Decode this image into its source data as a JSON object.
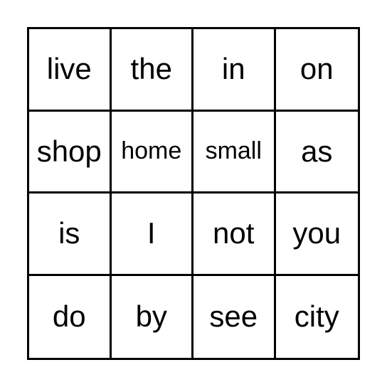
{
  "board": {
    "rows": [
      [
        "live",
        "the",
        "in",
        "on"
      ],
      [
        "shop",
        "home",
        "small",
        "as"
      ],
      [
        "is",
        "I",
        "not",
        "you"
      ],
      [
        "do",
        "by",
        "see",
        "city"
      ]
    ]
  },
  "colors": {
    "border": "#000000",
    "background": "#ffffff",
    "text": "#000000"
  }
}
